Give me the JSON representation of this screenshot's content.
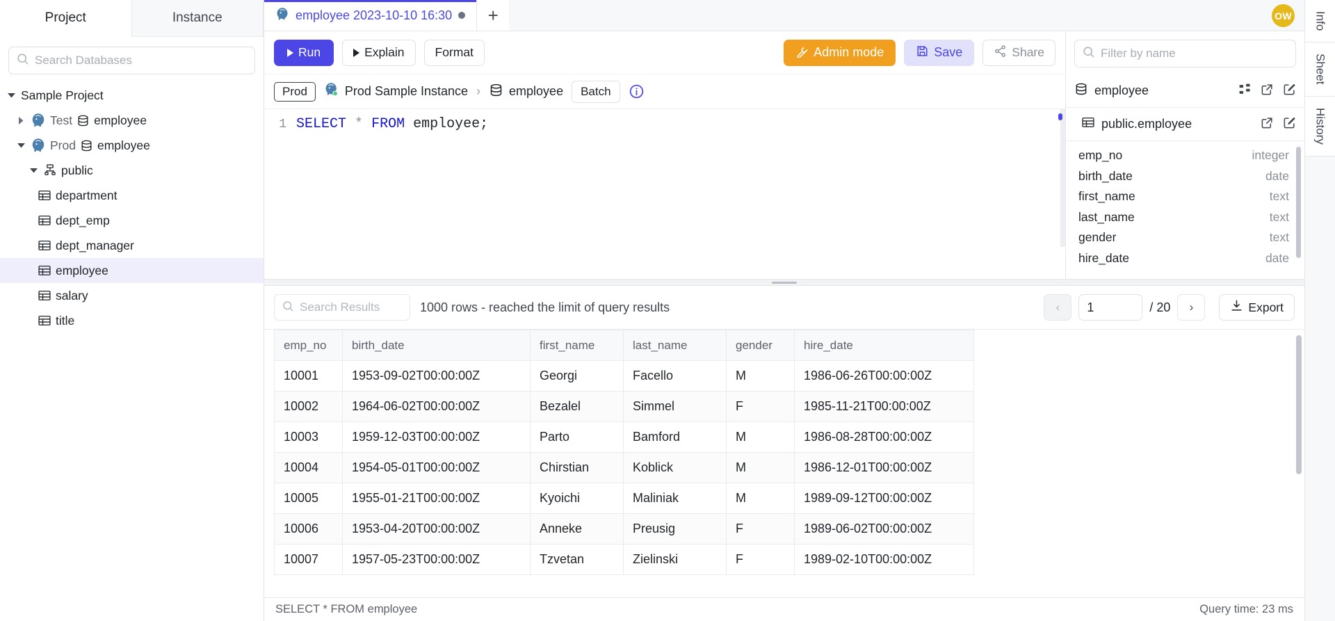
{
  "sidebar": {
    "tabs": [
      {
        "label": "Project",
        "active": true
      },
      {
        "label": "Instance",
        "active": false
      }
    ],
    "search_placeholder": "Search Databases",
    "tree": [
      {
        "label": "Sample Project",
        "depth": 0,
        "caret": "down",
        "icon": "none",
        "selected": false
      },
      {
        "label": "Test",
        "sub_label": "employee",
        "depth": 1,
        "caret": "right",
        "icon": "postgres",
        "selected": false
      },
      {
        "label": "Prod",
        "sub_label": "employee",
        "depth": 1,
        "caret": "down",
        "icon": "postgres",
        "selected": false
      },
      {
        "label": "public",
        "depth": 2,
        "caret": "down",
        "icon": "schema",
        "selected": false
      },
      {
        "label": "department",
        "depth": 3,
        "caret": "none",
        "icon": "table",
        "selected": false
      },
      {
        "label": "dept_emp",
        "depth": 3,
        "caret": "none",
        "icon": "table",
        "selected": false
      },
      {
        "label": "dept_manager",
        "depth": 3,
        "caret": "none",
        "icon": "table",
        "selected": false
      },
      {
        "label": "employee",
        "depth": 3,
        "caret": "none",
        "icon": "table",
        "selected": true
      },
      {
        "label": "salary",
        "depth": 3,
        "caret": "none",
        "icon": "table",
        "selected": false
      },
      {
        "label": "title",
        "depth": 3,
        "caret": "none",
        "icon": "table",
        "selected": false
      }
    ]
  },
  "editor_tabs": {
    "items": [
      {
        "label": "employee 2023-10-10 16:30",
        "icon": "postgres-icon",
        "dirty": true,
        "active": true
      }
    ],
    "add_label": "+"
  },
  "avatar": {
    "initials": "OW",
    "color": "#e5b91b"
  },
  "toolbar": {
    "run_label": "Run",
    "explain_label": "Explain",
    "format_label": "Format",
    "admin_label": "Admin mode",
    "save_label": "Save",
    "share_label": "Share"
  },
  "breadcrumb": {
    "env_label": "Prod",
    "instance_label": "Prod Sample Instance",
    "separator": "›",
    "database_label": "employee",
    "batch_label": "Batch"
  },
  "editor": {
    "line_number": "1",
    "keyword1": "SELECT",
    "star": "*",
    "keyword2": "FROM",
    "identifier": "employee;"
  },
  "schema_panel": {
    "filter_placeholder": "Filter by name",
    "database": "employee",
    "table": "public.employee",
    "columns": [
      {
        "name": "emp_no",
        "type": "integer"
      },
      {
        "name": "birth_date",
        "type": "date"
      },
      {
        "name": "first_name",
        "type": "text"
      },
      {
        "name": "last_name",
        "type": "text"
      },
      {
        "name": "gender",
        "type": "text"
      },
      {
        "name": "hire_date",
        "type": "date"
      }
    ]
  },
  "vertical_tabs": [
    {
      "label": "Info"
    },
    {
      "label": "Sheet"
    },
    {
      "label": "History"
    }
  ],
  "results": {
    "search_placeholder": "Search Results",
    "row_count_text": "1000 rows  -  reached the limit of query results",
    "page_value": "1",
    "page_total": "/ 20",
    "prev_label": "‹",
    "next_label": "›",
    "export_label": "Export",
    "columns": [
      "emp_no",
      "birth_date",
      "first_name",
      "last_name",
      "gender",
      "hire_date"
    ],
    "rows": [
      [
        "10001",
        "1953-09-02T00:00:00Z",
        "Georgi",
        "Facello",
        "M",
        "1986-06-26T00:00:00Z"
      ],
      [
        "10002",
        "1964-06-02T00:00:00Z",
        "Bezalel",
        "Simmel",
        "F",
        "1985-11-21T00:00:00Z"
      ],
      [
        "10003",
        "1959-12-03T00:00:00Z",
        "Parto",
        "Bamford",
        "M",
        "1986-08-28T00:00:00Z"
      ],
      [
        "10004",
        "1954-05-01T00:00:00Z",
        "Chirstian",
        "Koblick",
        "M",
        "1986-12-01T00:00:00Z"
      ],
      [
        "10005",
        "1955-01-21T00:00:00Z",
        "Kyoichi",
        "Maliniak",
        "M",
        "1989-09-12T00:00:00Z"
      ],
      [
        "10006",
        "1953-04-20T00:00:00Z",
        "Anneke",
        "Preusig",
        "F",
        "1989-06-02T00:00:00Z"
      ],
      [
        "10007",
        "1957-05-23T00:00:00Z",
        "Tzvetan",
        "Zielinski",
        "F",
        "1989-02-10T00:00:00Z"
      ]
    ]
  },
  "statusbar": {
    "query_text": "SELECT * FROM employee",
    "query_time": "Query time: 23 ms"
  },
  "colors": {
    "accent": "#4b46e5",
    "admin": "#f0a01e",
    "save_bg": "#e2e1fb",
    "selected_row": "#eeeefc"
  }
}
